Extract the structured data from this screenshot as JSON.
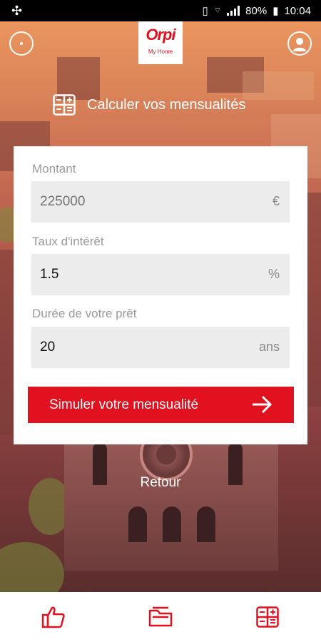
{
  "status_bar": {
    "battery": "80%",
    "time": "10:04"
  },
  "header": {
    "logo_text": "Orpi",
    "logo_sub": "My Home",
    "title": "Calculer vos mensualités"
  },
  "form": {
    "amount": {
      "label": "Montant",
      "placeholder": "225000",
      "unit": "€"
    },
    "rate": {
      "label": "Taux d'intérêt",
      "value": "1.5",
      "unit": "%"
    },
    "duration": {
      "label": "Durée de votre prêt",
      "value": "20",
      "unit": "ans"
    },
    "submit_label": "Simuler votre mensualité"
  },
  "back_label": "Retour",
  "colors": {
    "accent": "#e1111f",
    "field_bg": "#ececec",
    "label": "#9a9a9a"
  },
  "icons": {
    "more": "more-dots-icon",
    "user": "user-icon",
    "calculator": "calculator-icon",
    "submit": "arrow-right-icon",
    "tab_like": "thumbs-up-icon",
    "tab_folder": "folder-icon",
    "tab_calc": "calculator-icon"
  }
}
